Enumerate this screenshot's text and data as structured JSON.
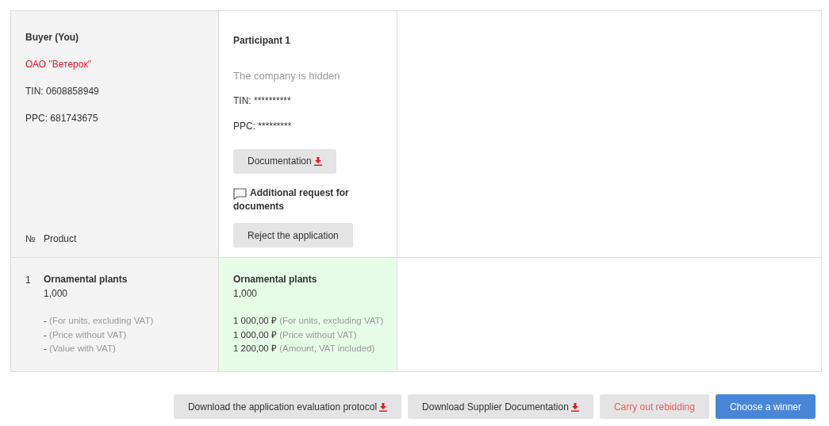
{
  "buyer": {
    "title": "Buyer (You)",
    "company": "ОАО \"Ветерок\"",
    "tin": "TIN: 0608858949",
    "ppc": "PPC: 681743675"
  },
  "participant": {
    "title": "Participant 1",
    "company": "The company is hidden",
    "tin": "TIN: **********",
    "ppc": "PPC: *********",
    "documentation_button": "Documentation",
    "request_link": "Additional request for documents",
    "reject_button": "Reject the application"
  },
  "table": {
    "columns": [
      "№",
      "Product"
    ],
    "rows": [
      {
        "number": "1",
        "buyer": {
          "name": "Ornamental plants",
          "quantity": "1,000",
          "prices": [
            {
              "value": "-",
              "note": "(For units, excluding VAT)"
            },
            {
              "value": "-",
              "note": "(Price without VAT)"
            },
            {
              "value": "-",
              "note": "(Value with VAT)"
            }
          ]
        },
        "participant": {
          "name": "Ornamental plants",
          "quantity": "1,000",
          "prices": [
            {
              "value": "1 000,00 ₽",
              "note": "(For units, excluding VAT)"
            },
            {
              "value": "1 000,00 ₽",
              "note": "(Price without VAT)"
            },
            {
              "value": "1 200,00 ₽",
              "note": "(Amount, VAT included)"
            }
          ]
        }
      }
    ]
  },
  "actions": [
    {
      "label": "Download the application evaluation protocol",
      "kind": "download"
    },
    {
      "label": "Download Supplier Documentation",
      "kind": "download"
    },
    {
      "label": "Carry out rebidding",
      "kind": "danger"
    },
    {
      "label": "Choose a winner",
      "kind": "primary"
    }
  ]
}
